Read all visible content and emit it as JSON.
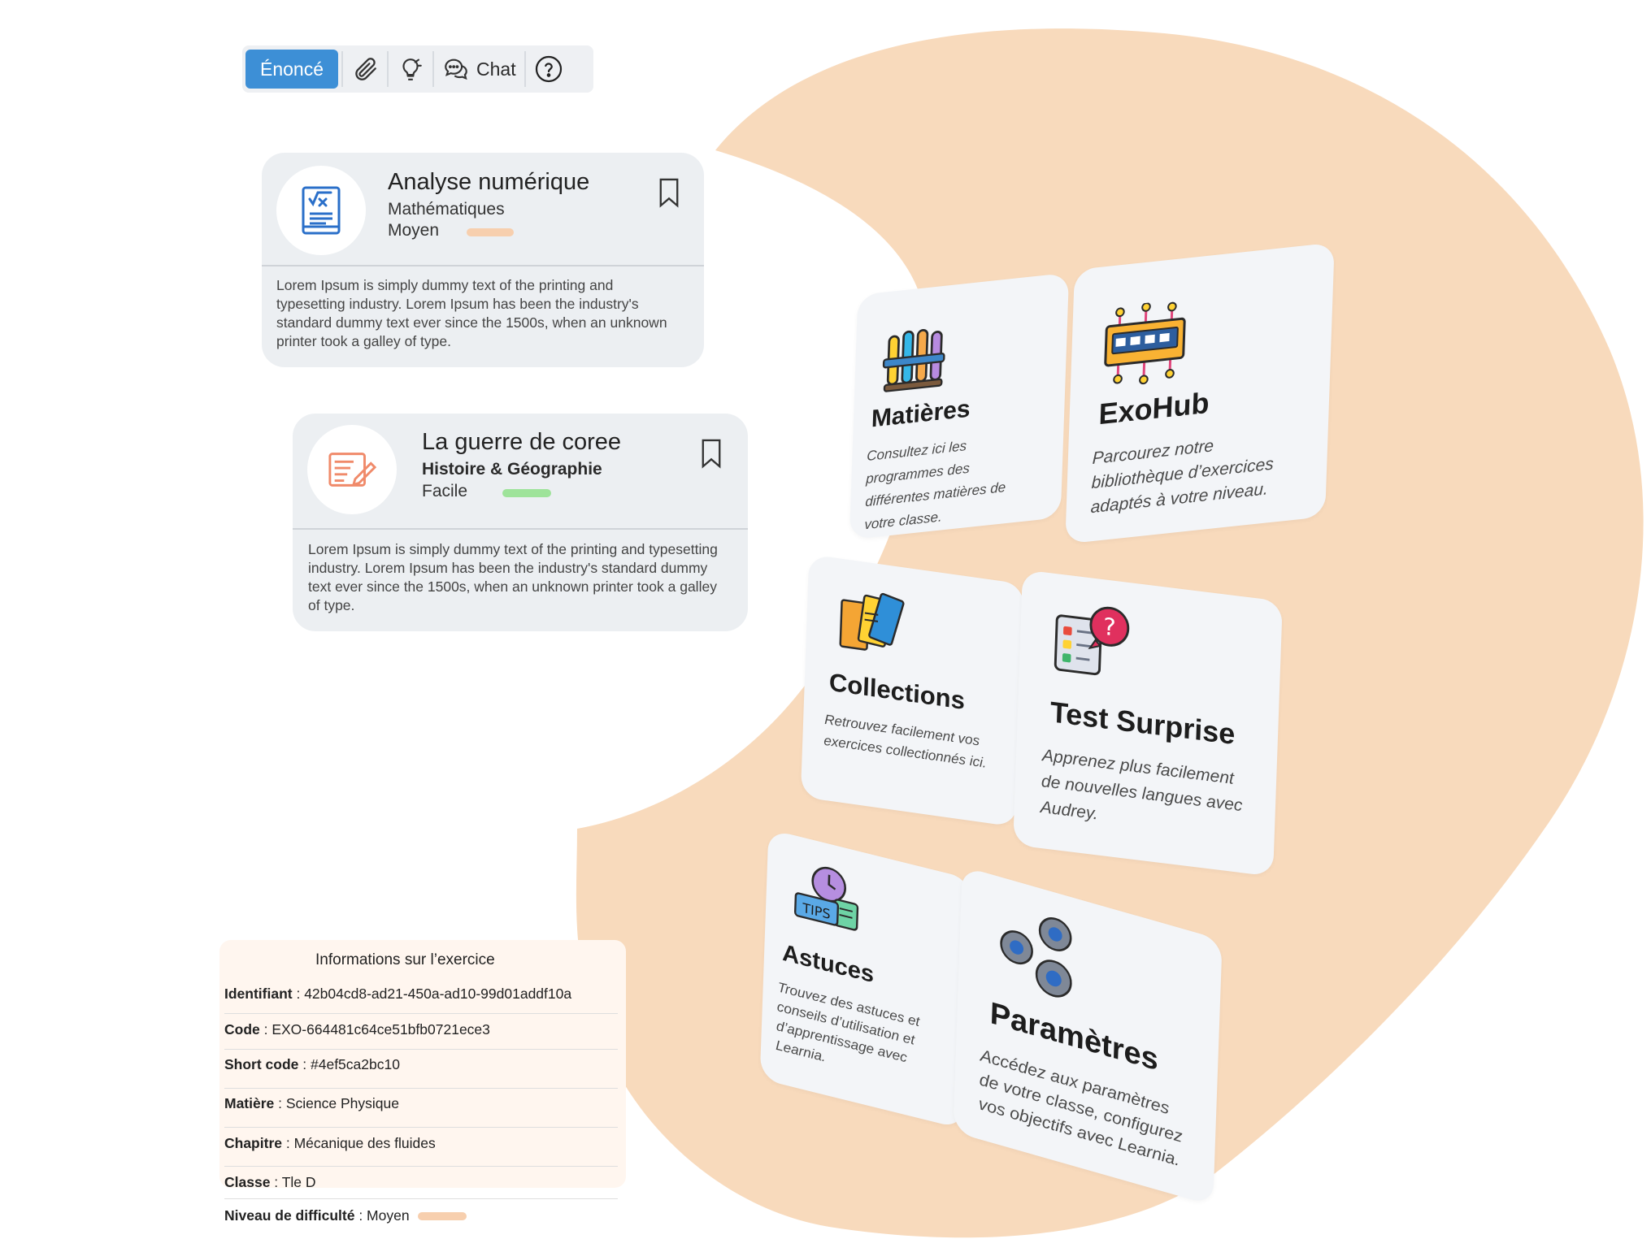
{
  "toolbar": {
    "statement_label": "Énoncé",
    "chat_label": "Chat"
  },
  "exercise_cards": [
    {
      "title": "Analyse numérique",
      "subject": "Mathématiques",
      "level": "Moyen",
      "level_color": "#f7cfae",
      "icon": "math-book-icon",
      "description": "Lorem Ipsum is simply dummy text of the printing and typesetting industry. Lorem Ipsum has been the industry's standard dummy  text ever since the 1500s, when an unknown printer took a galley of  type."
    },
    {
      "title": "La guerre de coree",
      "subject": "Histoire & Géographie",
      "level": "Facile",
      "level_color": "#9ee39a",
      "icon": "document-edit-icon",
      "description": "Lorem Ipsum is simply dummy text of the printing and typesetting industry. Lorem Ipsum has been the industry's standard dummy  text ever since the 1500s, when an unknown printer took a galley of  type."
    }
  ],
  "info": {
    "title": "Informations sur l’exercice",
    "rows": [
      {
        "label": "Identifiant",
        "value": " : 42b04cd8-ad21-450a-ad10-99d01addf10a"
      },
      {
        "label": "Code",
        "value": " : EXO-664481c64ce51bfb0721ece3"
      },
      {
        "label": "Short code",
        "value": " : #4ef5ca2bc10"
      },
      {
        "label": "Matière",
        "value": " : Science Physique"
      },
      {
        "label": "Chapitre",
        "value": " : Mécanique des fluides"
      },
      {
        "label": "Classe",
        "value": " : Tle D"
      },
      {
        "label": "Niveau de difficulté",
        "value": " : Moyen"
      }
    ],
    "level_color": "#f7cfae"
  },
  "tiles": [
    {
      "title": "Matières",
      "description": "Consultez ici les programmes des différentes matières de votre classe.",
      "icon": "test-tubes-icon"
    },
    {
      "title": "ExoHub",
      "description": "Parcourez notre bibliothèque d’exercices adaptés à votre niveau.",
      "icon": "network-hub-icon"
    },
    {
      "title": "Collections",
      "description": "Retrouvez facilement vos exercices collectionnés ici.",
      "icon": "books-icon"
    },
    {
      "title": "Test Surprise",
      "description": "Apprenez plus facilement de nouvelles langues avec Audrey.",
      "icon": "quiz-question-icon"
    },
    {
      "title": "Astuces",
      "description": "Trouvez des astuces et conseils d’utilisation et d’apprentissage avec Learnia.",
      "icon": "tips-icon"
    },
    {
      "title": "Paramètres",
      "description": "Accédez aux paramètres de votre classe, configurez vos objectifs avec Learnia.",
      "icon": "gears-icon"
    }
  ],
  "colors": {
    "accent": "#3d8fd6",
    "blob": "#f8dabc",
    "card_bg": "#eceff2",
    "tile_bg": "#f3f5f8"
  }
}
